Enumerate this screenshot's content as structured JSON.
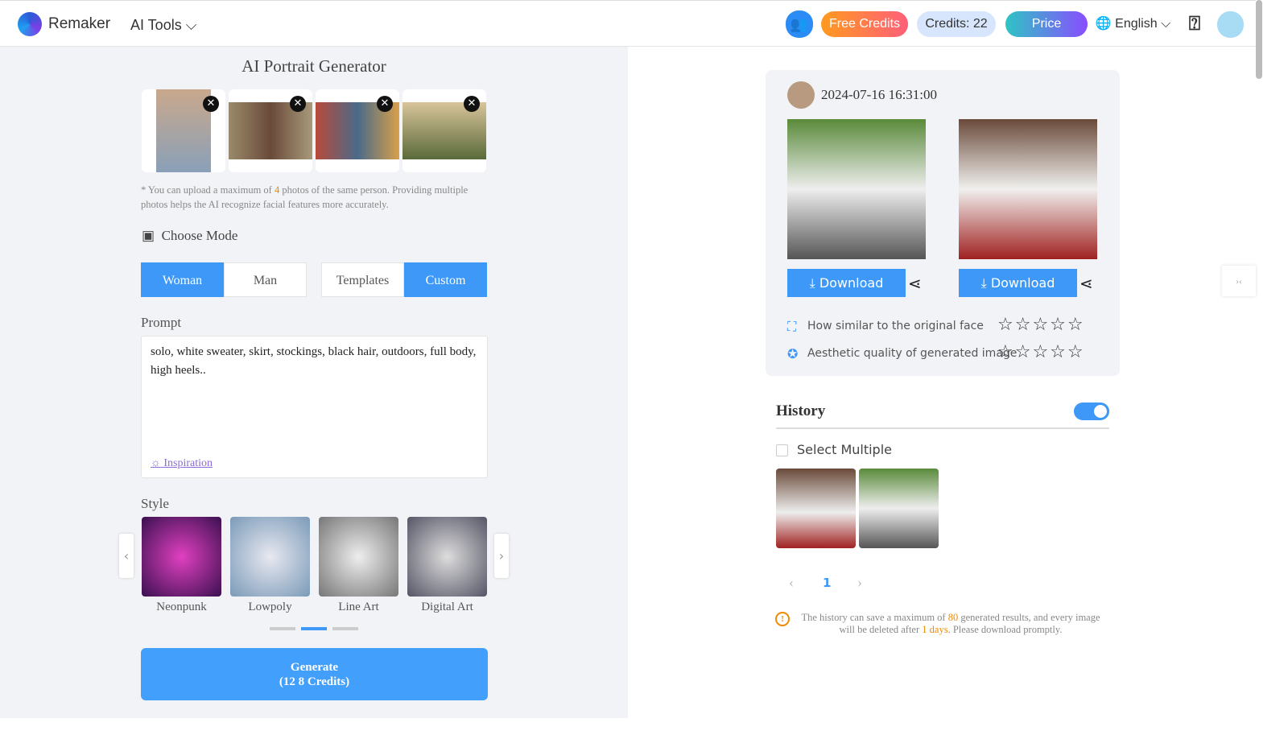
{
  "header": {
    "brand": "Remaker",
    "ai_tools": "AI Tools",
    "free_credits": "Free Credits",
    "credits": "Credits: 22",
    "price": "Price",
    "language": "English"
  },
  "left": {
    "title": "AI Portrait Generator",
    "upload_note_pre": "* You can upload a maximum of ",
    "upload_max": "4",
    "upload_note_post": " photos of the same person. Providing multiple photos helps the AI recognize facial features more accurately.",
    "choose_mode": "Choose Mode",
    "modes": [
      "Woman",
      "Man"
    ],
    "types": [
      "Templates",
      "Custom"
    ],
    "selected_mode": "Woman",
    "selected_type": "Custom",
    "prompt_label": "Prompt",
    "prompt_value": "solo, white sweater, skirt, stockings, black hair, outdoors, full body, high  heels..",
    "inspiration": "Inspiration",
    "style_label": "Style",
    "styles": [
      "Neonpunk",
      "Lowpoly",
      "Line Art",
      "Digital Art"
    ],
    "style_page": 2,
    "generate": "Generate",
    "credits_old": "12",
    "credits_new": "(12 8 Credits)"
  },
  "result": {
    "timestamp": "2024-07-16 16:31:00",
    "download": "Download",
    "q1": "How similar to the original face",
    "q2": "Aesthetic quality of generated image",
    "stars": "☆☆☆☆☆"
  },
  "history": {
    "title": "History",
    "toggle_on": true,
    "select_multiple": "Select Multiple",
    "page": "1",
    "note_pre": "The history can save a maximum of ",
    "max": "80",
    "note_mid": " generated results, and every image will be deleted after ",
    "days": "1 days",
    "note_post": ". Please download promptly."
  },
  "colors": {
    "accent": "#3d98f7",
    "orange": "#f08a00"
  }
}
